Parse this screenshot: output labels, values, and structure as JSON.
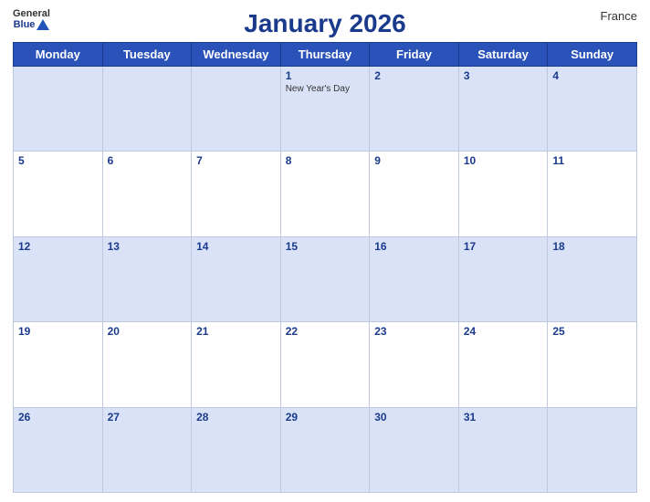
{
  "header": {
    "title": "January 2026",
    "country": "France",
    "logo_general": "General",
    "logo_blue": "Blue"
  },
  "weekdays": [
    "Monday",
    "Tuesday",
    "Wednesday",
    "Thursday",
    "Friday",
    "Saturday",
    "Sunday"
  ],
  "weeks": [
    {
      "shaded": true,
      "days": [
        {
          "num": "",
          "event": ""
        },
        {
          "num": "",
          "event": ""
        },
        {
          "num": "",
          "event": ""
        },
        {
          "num": "1",
          "event": "New Year's Day"
        },
        {
          "num": "2",
          "event": ""
        },
        {
          "num": "3",
          "event": ""
        },
        {
          "num": "4",
          "event": ""
        }
      ]
    },
    {
      "shaded": false,
      "days": [
        {
          "num": "5",
          "event": ""
        },
        {
          "num": "6",
          "event": ""
        },
        {
          "num": "7",
          "event": ""
        },
        {
          "num": "8",
          "event": ""
        },
        {
          "num": "9",
          "event": ""
        },
        {
          "num": "10",
          "event": ""
        },
        {
          "num": "11",
          "event": ""
        }
      ]
    },
    {
      "shaded": true,
      "days": [
        {
          "num": "12",
          "event": ""
        },
        {
          "num": "13",
          "event": ""
        },
        {
          "num": "14",
          "event": ""
        },
        {
          "num": "15",
          "event": ""
        },
        {
          "num": "16",
          "event": ""
        },
        {
          "num": "17",
          "event": ""
        },
        {
          "num": "18",
          "event": ""
        }
      ]
    },
    {
      "shaded": false,
      "days": [
        {
          "num": "19",
          "event": ""
        },
        {
          "num": "20",
          "event": ""
        },
        {
          "num": "21",
          "event": ""
        },
        {
          "num": "22",
          "event": ""
        },
        {
          "num": "23",
          "event": ""
        },
        {
          "num": "24",
          "event": ""
        },
        {
          "num": "25",
          "event": ""
        }
      ]
    },
    {
      "shaded": true,
      "days": [
        {
          "num": "26",
          "event": ""
        },
        {
          "num": "27",
          "event": ""
        },
        {
          "num": "28",
          "event": ""
        },
        {
          "num": "29",
          "event": ""
        },
        {
          "num": "30",
          "event": ""
        },
        {
          "num": "31",
          "event": ""
        },
        {
          "num": "",
          "event": ""
        }
      ]
    }
  ]
}
